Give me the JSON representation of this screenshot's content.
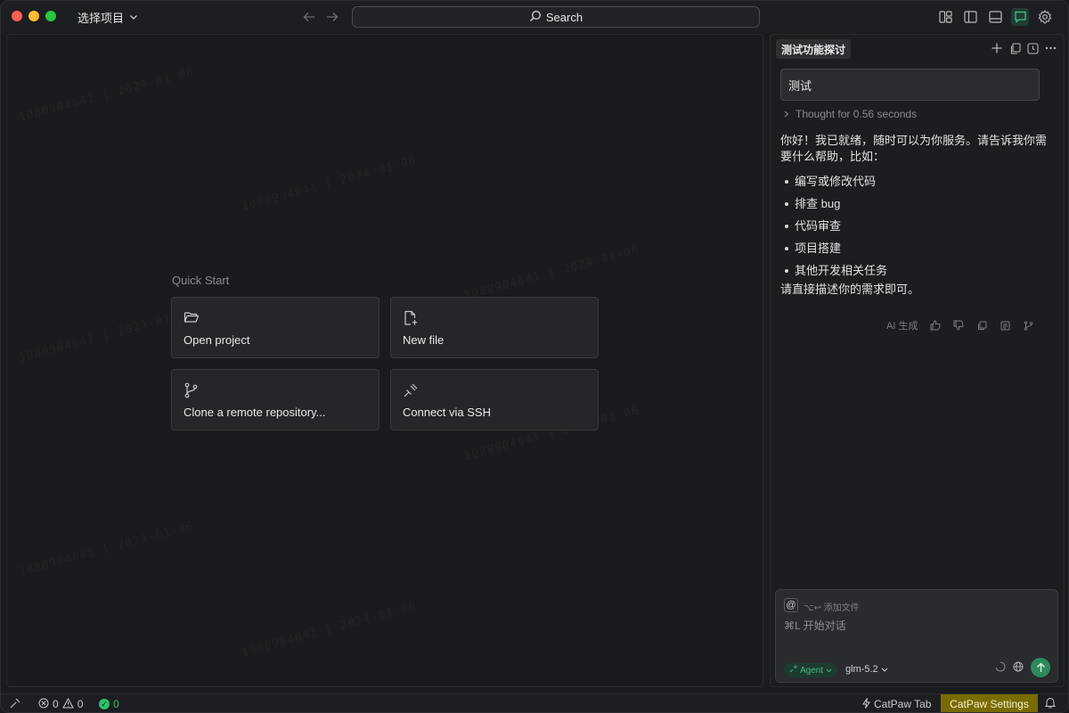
{
  "titlebar": {
    "project_label": "选择项目",
    "search_label": "Search"
  },
  "quick_start": {
    "title": "Quick Start",
    "cards": [
      {
        "label": "Open project",
        "icon": "folder-open-icon"
      },
      {
        "label": "New file",
        "icon": "file-plus-icon"
      },
      {
        "label": "Clone a remote repository...",
        "icon": "git-branch-icon"
      },
      {
        "label": "Connect via SSH",
        "icon": "plug-icon"
      }
    ]
  },
  "watermark_text": "1080904641 | 2024-01-06",
  "chat": {
    "tab_title": "测试功能探讨",
    "user_message": "测试",
    "thought_label": "Thought for 0.56 seconds",
    "reply_intro": "你好！我已就绪，随时可以为你服务。请告诉我你需要什么帮助，比如：",
    "reply_items": [
      "编写或修改代码",
      "排查 bug",
      "代码审查",
      "项目搭建",
      "其他开发相关任务"
    ],
    "reply_closing": "请直接描述你的需求即可。",
    "ai_generated_label": "AI 生成",
    "composer": {
      "add_file_hint": "⌥↩ 添加文件",
      "placeholder": "⌘L 开始对话",
      "agent_label": "Agent",
      "model_label": "glm-5.2"
    }
  },
  "statusbar": {
    "errors": "0",
    "warnings": "0",
    "checks": "0",
    "catpaw_tab": "CatPaw Tab",
    "catpaw_settings": "CatPaw Settings"
  },
  "colors": {
    "accent_green": "#2c8a5c",
    "settings_bg": "#7a6b00"
  }
}
